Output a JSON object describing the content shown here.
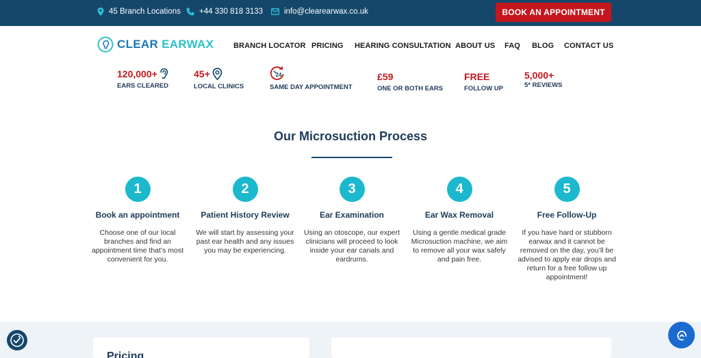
{
  "topbar": {
    "locations": "45 Branch Locations",
    "phone": "+44 330 818 3133",
    "email": "info@clearearwax.co.uk",
    "book_button": "BOOK AN APPOINTMENT"
  },
  "logo": {
    "word1": "CLEAR",
    "word2": "EARWAX"
  },
  "nav": [
    "BRANCH LOCATOR",
    "PRICING",
    "HEARING CONSULTATION",
    "ABOUT US",
    "FAQ",
    "BLOG",
    "CONTACT US"
  ],
  "stats": [
    {
      "value": "120,000+",
      "label": "EARS CLEARED",
      "icon": "ear-icon"
    },
    {
      "value": "45+",
      "label": "LOCAL CLINICS",
      "icon": "location-pin-icon"
    },
    {
      "value": "",
      "label": "SAME DAY APPOINTMENT",
      "icon": "24-hour-icon"
    },
    {
      "value": "£59",
      "label": "ONE OR BOTH EARS"
    },
    {
      "value": "FREE",
      "label": "FOLLOW UP"
    },
    {
      "value": "5,000+",
      "label": "5* REVIEWS"
    }
  ],
  "process": {
    "title": "Our Microsuction Process",
    "steps": [
      {
        "number": "1",
        "title": "Book an appointment",
        "desc": "Choose one of our local branches and find an appointment time that’s most convenient for you."
      },
      {
        "number": "2",
        "title": "Patient History Review",
        "desc": "We will start by assessing your past ear health and any issues you may be experiencing."
      },
      {
        "number": "3",
        "title": "Ear Examination",
        "desc": "Using an otoscope, our expert clinicians will proceed to look inside your ear canals and eardrums."
      },
      {
        "number": "4",
        "title": "Ear Wax Removal",
        "desc": "Using a gentle medical grade Microsuction machine, we aim to remove all your wax safely and pain free."
      },
      {
        "number": "5",
        "title": "Free Follow-Up",
        "desc": "If you have hard or stubborn earwax and it cannot be removed on the day, you’ll be advised to apply ear drops and return for a free follow up appointment!"
      }
    ]
  },
  "pricing": {
    "title": "Pricing"
  },
  "colors": {
    "navy": "#15476b",
    "accent_red": "#c4161c",
    "teal": "#1cb8cd",
    "chat_blue": "#1b6ad1"
  }
}
